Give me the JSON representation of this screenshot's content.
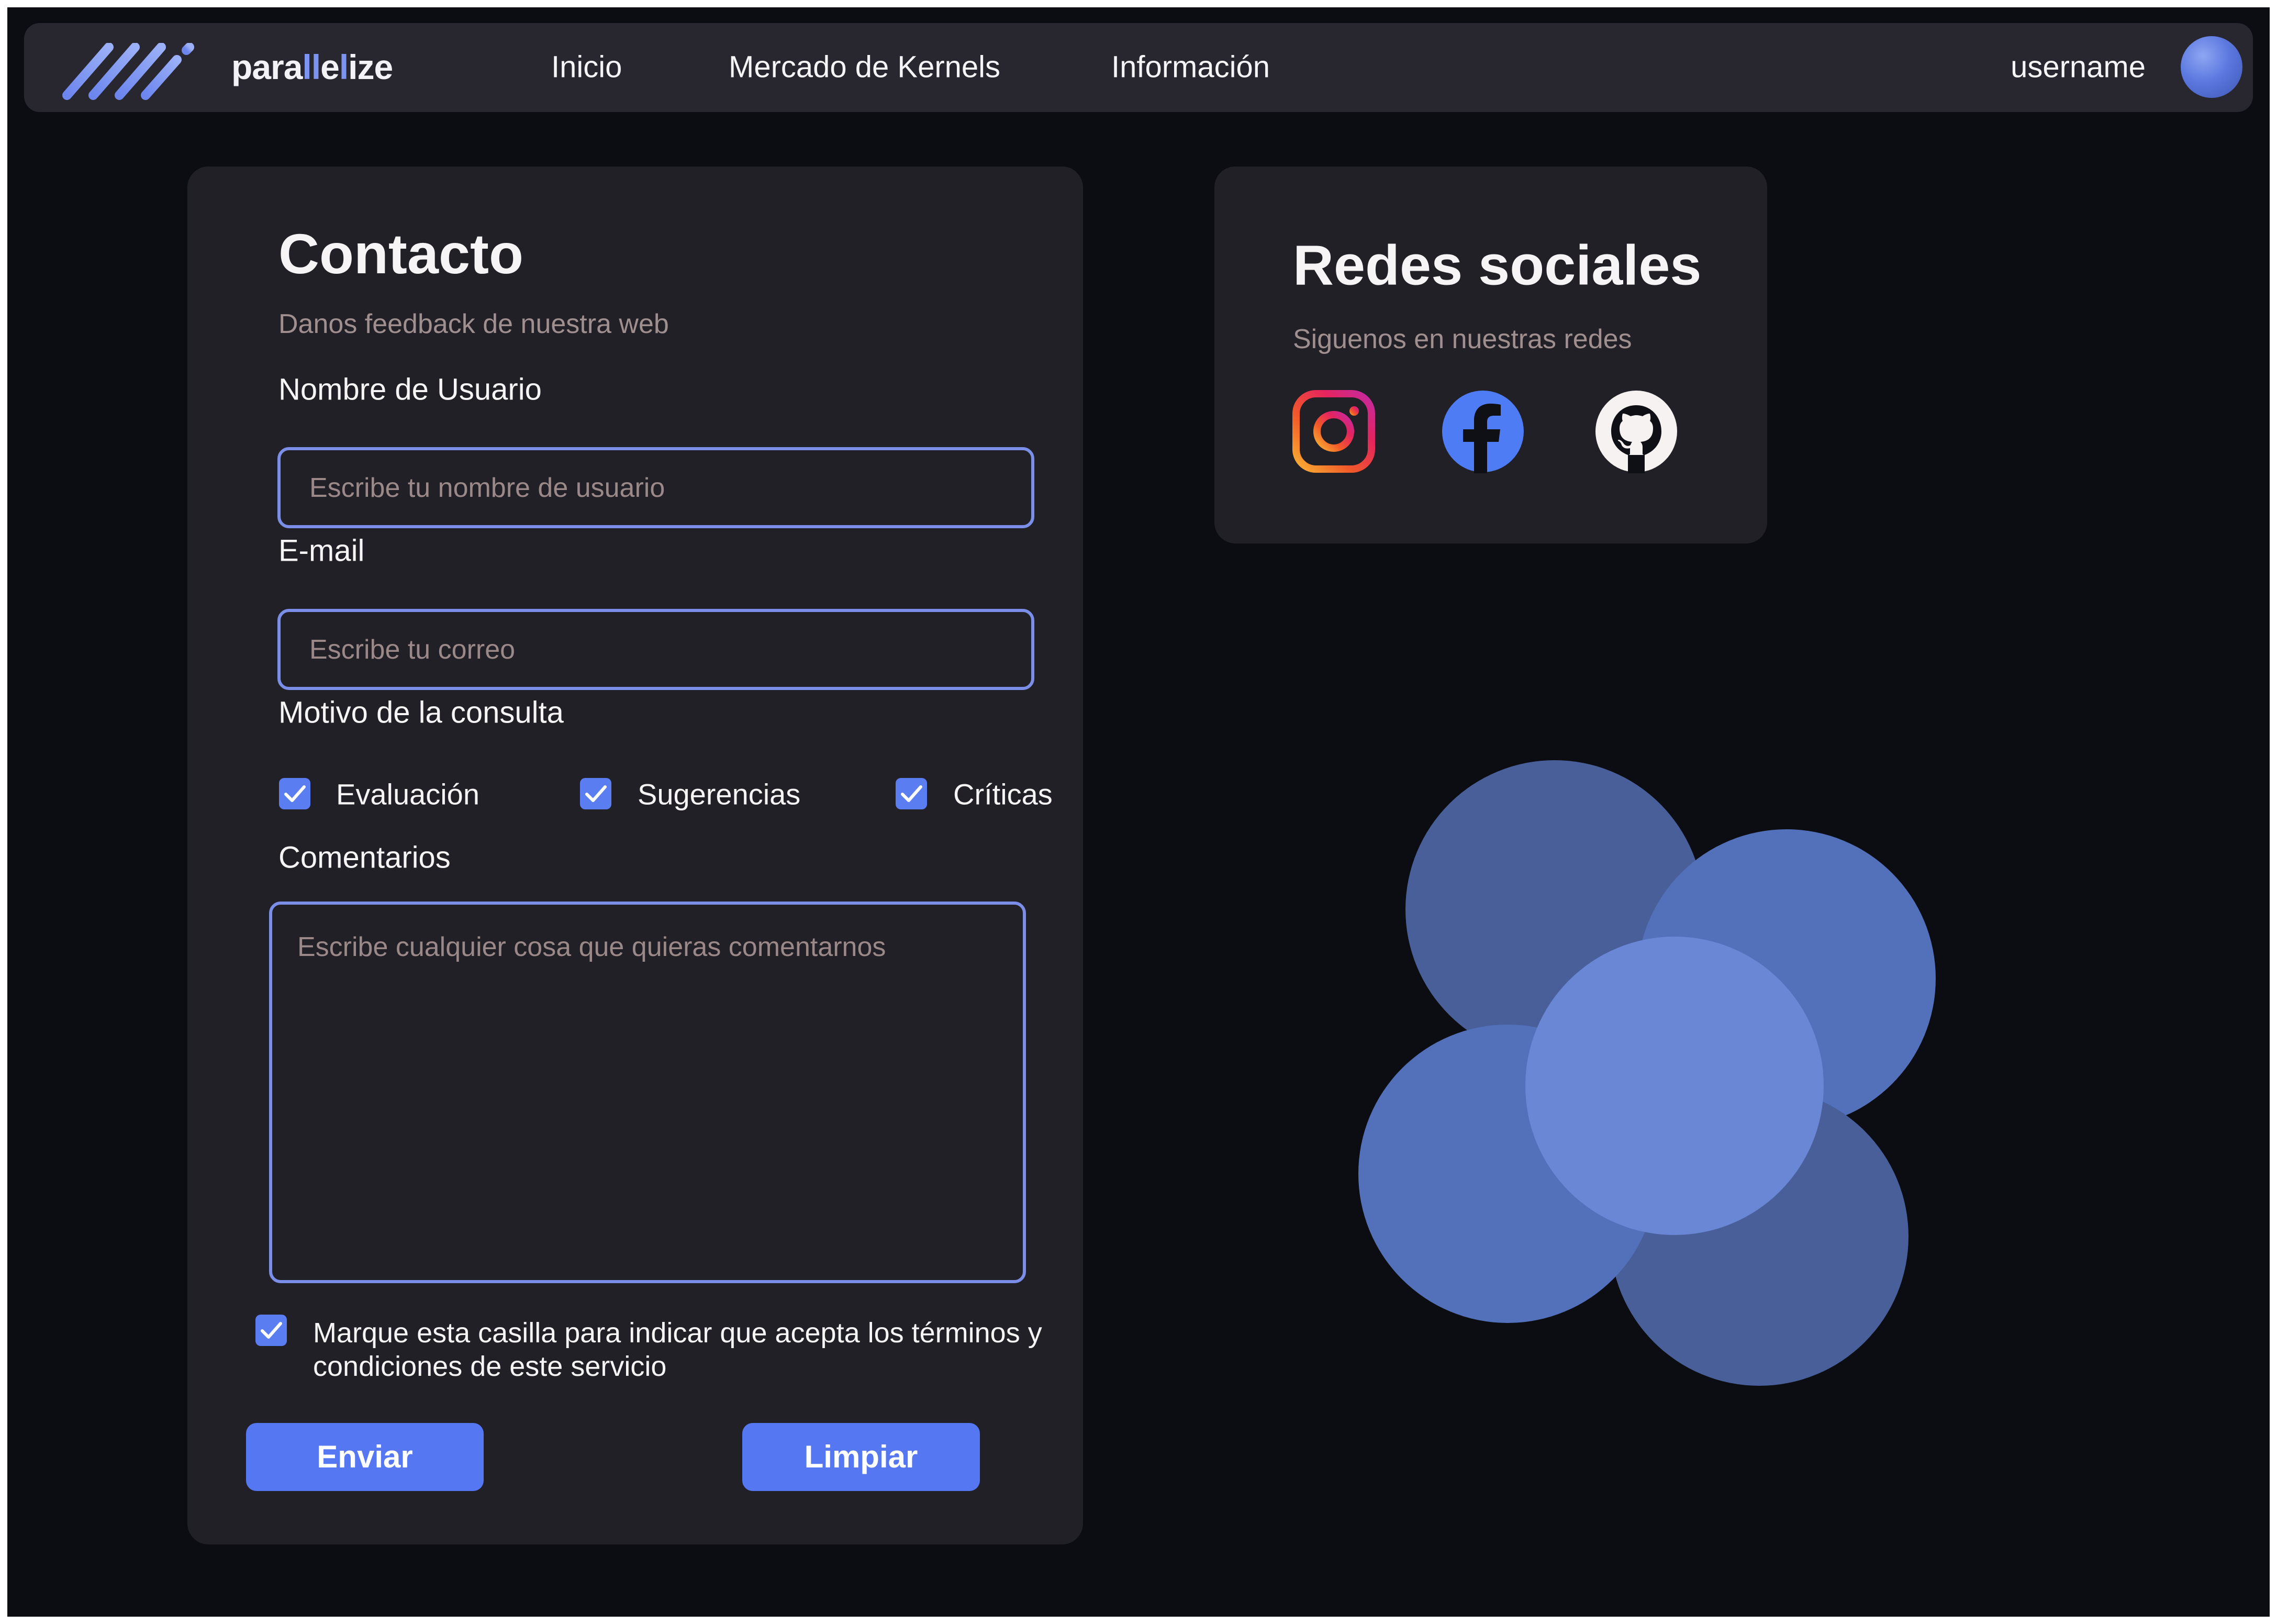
{
  "navbar": {
    "brand_part1": "para",
    "brand_accent": "ll",
    "brand_part2": "e",
    "brand_accent2": "l",
    "brand_part3": "ize",
    "links": [
      "Inicio",
      "Mercado de Kernels",
      "Información"
    ],
    "username": "username"
  },
  "contact": {
    "title": "Contacto",
    "subtitle": "Danos feedback de nuestra web",
    "username_label": "Nombre de Usuario",
    "username_placeholder": "Escribe tu nombre de usuario",
    "email_label": "E-mail",
    "email_placeholder": "Escribe tu correo",
    "motivo_label": "Motivo de la consulta",
    "reasons": [
      {
        "label": "Evaluación",
        "checked": true
      },
      {
        "label": "Sugerencias",
        "checked": true
      },
      {
        "label": "Críticas",
        "checked": true
      }
    ],
    "comments_label": "Comentarios",
    "comments_placeholder": "Escribe cualquier cosa que quieras comentarnos",
    "terms_text": "Marque esta casilla para indicar que acepta los términos y condiciones de este servicio",
    "terms_checked": true,
    "submit_label": "Enviar",
    "clear_label": "Limpiar"
  },
  "social": {
    "title": "Redes sociales",
    "subtitle": "Siguenos en nuestras redes",
    "icons": [
      "instagram-icon",
      "facebook-icon",
      "github-icon"
    ]
  },
  "colors": {
    "background": "#0c0d12",
    "panel": "#212026",
    "navbar": "#282730",
    "accent": "#5578f2",
    "input_border": "#7b8ee8",
    "muted_text": "#a08f8f"
  }
}
